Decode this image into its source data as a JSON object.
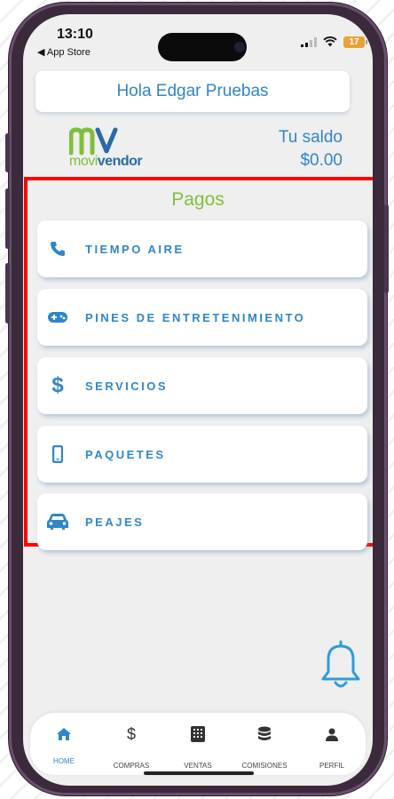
{
  "status_bar": {
    "time": "13:10",
    "back_label": "App Store",
    "battery": "17"
  },
  "header": {
    "greeting": "Hola Edgar Pruebas"
  },
  "brand": {
    "logo_mark": "mv",
    "logo_text_prefix": "movi",
    "logo_text_suffix": "vendor"
  },
  "balance": {
    "label": "Tu saldo",
    "value": "$0.00"
  },
  "payments": {
    "title": "Pagos",
    "items": [
      {
        "label": "TIEMPO AIRE",
        "icon": "phone-icon"
      },
      {
        "label": "PINES DE ENTRETENIMIENTO",
        "icon": "gamepad-icon"
      },
      {
        "label": "SERVICIOS",
        "icon": "dollar-icon"
      },
      {
        "label": "PAQUETES",
        "icon": "mobile-icon"
      },
      {
        "label": "PEAJES",
        "icon": "car-icon"
      }
    ]
  },
  "bottom_nav": {
    "active": "HOME",
    "items": [
      {
        "label": "HOME",
        "icon": "home-icon"
      },
      {
        "label": "COMPRAS",
        "icon": "dollar-icon"
      },
      {
        "label": "VENTAS",
        "icon": "calculator-icon"
      },
      {
        "label": "COMISIONES",
        "icon": "coins-icon"
      },
      {
        "label": "PERFIL",
        "icon": "user-icon"
      }
    ]
  },
  "colors": {
    "accent": "#2f86c8",
    "brand_green": "#7fbf3a",
    "highlight": "#ff0000"
  }
}
